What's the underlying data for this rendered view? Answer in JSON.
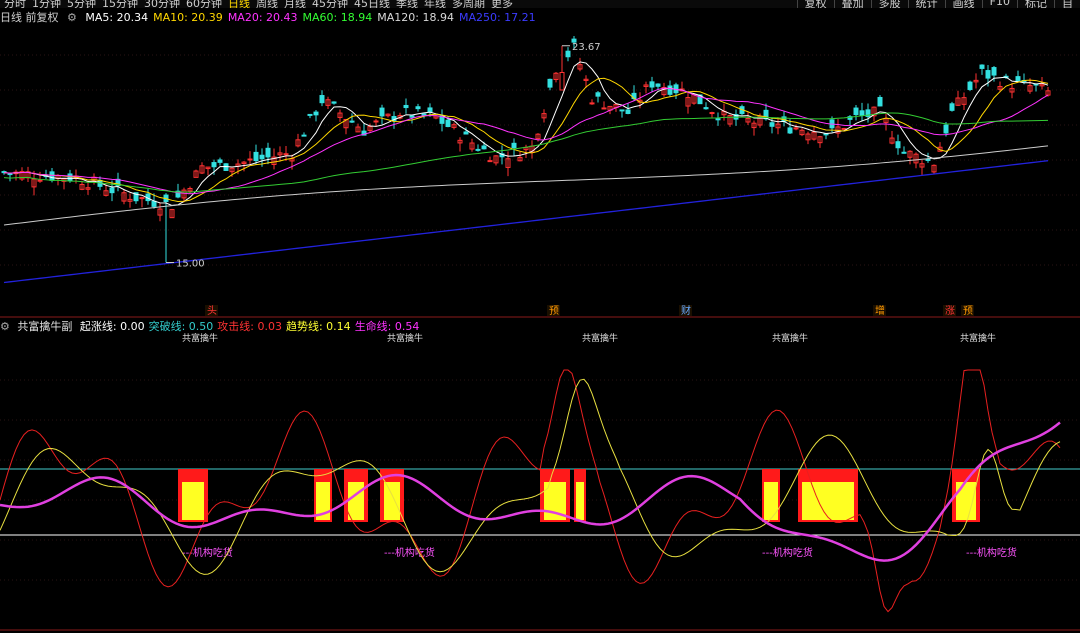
{
  "toolbar": {
    "periods": [
      "分时",
      "1分钟",
      "5分钟",
      "15分钟",
      "30分钟",
      "60分钟",
      "日线",
      "周线",
      "月线",
      "45分钟",
      "45日线",
      "季线",
      "年线",
      "多周期",
      "更多"
    ],
    "right_buttons": [
      "复权",
      "叠加",
      "多股",
      "统计",
      "画线",
      "F10",
      "标记",
      "自"
    ]
  },
  "main_legend": {
    "title": "日线 前复权",
    "items": [
      {
        "label": "MA5: 20.34",
        "color": "#ffffff"
      },
      {
        "label": "MA10: 20.39",
        "color": "#ffd700"
      },
      {
        "label": "MA20: 20.43",
        "color": "#ff33ff"
      },
      {
        "label": "MA60: 18.94",
        "color": "#33ff33"
      },
      {
        "label": "MA120: 18.94",
        "color": "#d8d8d8"
      },
      {
        "label": "MA250: 17.21",
        "color": "#3b3bff"
      }
    ]
  },
  "price_labels": {
    "high": "23.67",
    "low": "15.00"
  },
  "event_markers": [
    {
      "label": "头",
      "color": "#ff3333"
    },
    {
      "label": "预",
      "color": "#ff9900"
    },
    {
      "label": "财",
      "color": "#66aaff"
    },
    {
      "label": "增",
      "color": "#ff9900"
    },
    {
      "label": "涨",
      "color": "#ff3333"
    },
    {
      "label": "预",
      "color": "#ff9900"
    }
  ],
  "indicator_legend": {
    "name": "共富擒牛副",
    "items": [
      {
        "label": "起涨线: 0.00",
        "color": "#ffffff"
      },
      {
        "label": "突破线: 0.50",
        "color": "#33cccc"
      },
      {
        "label": "攻击线: 0.03",
        "color": "#ff3333"
      },
      {
        "label": "趋势线: 0.14",
        "color": "#ffff33"
      },
      {
        "label": "生命线: 0.54",
        "color": "#ff33ff"
      }
    ]
  },
  "signal_label": "共富擒牛",
  "zone_label": "---机构吃货",
  "colors": {
    "up": "#ff3232",
    "down": "#33e0e0",
    "ma5": "#ffffff",
    "ma10": "#ffd700",
    "ma20": "#ff33ff",
    "ma60": "#33cc33",
    "ma120": "#cccccc",
    "ma250": "#2222dd",
    "attack": "#e82020",
    "trend": "#e8e040",
    "life": "#e040e0",
    "breakout": "#44cccc",
    "base": "#ffffff"
  }
}
